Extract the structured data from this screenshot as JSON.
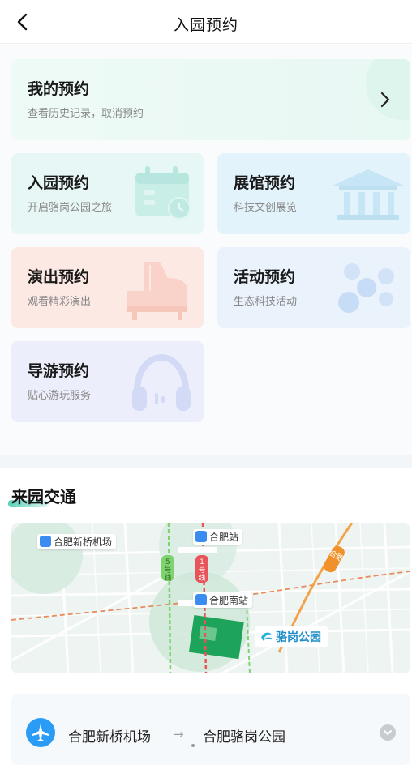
{
  "nav": {
    "title": "入园预约"
  },
  "my_booking": {
    "title": "我的预约",
    "subtitle": "查看历史记录，取消预约"
  },
  "cards": [
    {
      "title": "入园预约",
      "subtitle": "开启骆岗公园之旅",
      "color": "#e6f7f5",
      "deco": "calendar-icon"
    },
    {
      "title": "展馆预约",
      "subtitle": "科技文创展览",
      "color": "#e3f3fb",
      "deco": "pavilion-icon"
    },
    {
      "title": "演出预约",
      "subtitle": "观看精彩演出",
      "color": "#fde9e4",
      "deco": "piano-icon"
    },
    {
      "title": "活动预约",
      "subtitle": "生态科技活动",
      "color": "#eaf2fc",
      "deco": "molecule-icon"
    },
    {
      "title": "导游预约",
      "subtitle": "贴心游玩服务",
      "color": "#eceffb",
      "deco": "headphones-icon"
    }
  ],
  "traffic": {
    "title": "来园交通",
    "map": {
      "labels": {
        "airport": "合肥新桥机场",
        "station": "合肥站",
        "south_station": "合肥南站",
        "park": "骆岗公园",
        "line5": "5号线",
        "line1": "1号线",
        "highway": "合肥"
      }
    },
    "route": {
      "from": "合肥新桥机场",
      "arrow": "→",
      "to": "合肥骆岗公园"
    }
  }
}
